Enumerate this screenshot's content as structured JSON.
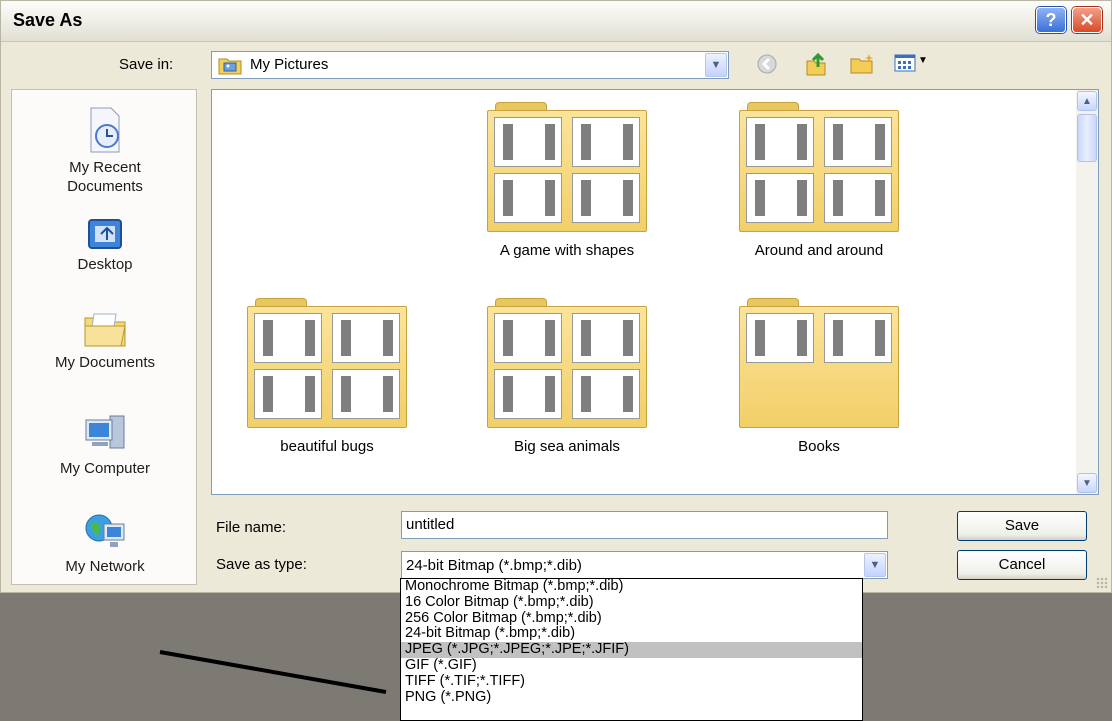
{
  "dialog": {
    "title": "Save As",
    "help_glyph": "?",
    "close_glyph": "✕"
  },
  "toolbar": {
    "save_in_label": "Save in:",
    "save_in_value": "My Pictures",
    "icons": [
      "back-icon",
      "up-folder-icon",
      "new-folder-icon",
      "views-menu-icon"
    ]
  },
  "places": [
    {
      "icon": "recent-documents-icon",
      "label": "My Recent\nDocuments"
    },
    {
      "icon": "desktop-icon",
      "label": "Desktop"
    },
    {
      "icon": "my-documents-icon",
      "label": "My Documents"
    },
    {
      "icon": "my-computer-icon",
      "label": "My Computer"
    },
    {
      "icon": "my-network-icon",
      "label": "My Network"
    }
  ],
  "folders": [
    {
      "name": "A game with shapes",
      "shots": 4
    },
    {
      "name": "Around and around",
      "shots": 4
    },
    {
      "name": "beautiful bugs",
      "shots": 4
    },
    {
      "name": "Big sea animals",
      "shots": 4
    },
    {
      "name": "Books",
      "shots": 2
    }
  ],
  "form": {
    "file_name_label": "File name:",
    "file_name_value": "untitled",
    "type_label": "Save as type:",
    "type_value": "24-bit Bitmap (*.bmp;*.dib)"
  },
  "buttons": {
    "save": "Save",
    "cancel": "Cancel"
  },
  "type_options": [
    "Monochrome Bitmap (*.bmp;*.dib)",
    "16 Color Bitmap (*.bmp;*.dib)",
    "256 Color Bitmap (*.bmp;*.dib)",
    "24-bit Bitmap (*.bmp;*.dib)",
    "JPEG (*.JPG;*.JPEG;*.JPE;*.JFIF)",
    "GIF (*.GIF)",
    "TIFF (*.TIF;*.TIFF)",
    "PNG (*.PNG)"
  ],
  "selected_type_option": "JPEG (*.JPG;*.JPEG;*.JPE;*.JFIF)",
  "colors": {
    "dialog_bg": "#ece9d8",
    "selection_bg": "#c1c1c1",
    "folder_yellow": "#f2cf68",
    "backdrop": "#7d7a74"
  }
}
